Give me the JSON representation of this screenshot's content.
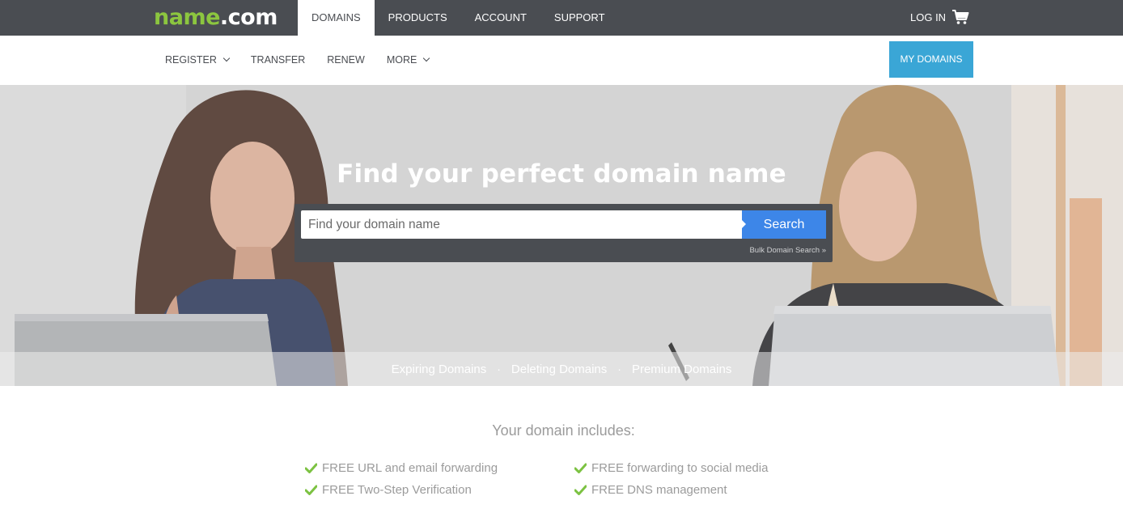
{
  "brand": {
    "part1": "name",
    "part2": ".com"
  },
  "topnav": {
    "items": [
      {
        "label": "DOMAINS",
        "active": true
      },
      {
        "label": "PRODUCTS"
      },
      {
        "label": "ACCOUNT"
      },
      {
        "label": "SUPPORT"
      }
    ],
    "login_label": "LOG IN",
    "cart_icon": "shopping-cart-icon"
  },
  "subnav": {
    "items": [
      {
        "label": "REGISTER",
        "has_dropdown": true
      },
      {
        "label": "TRANSFER"
      },
      {
        "label": "RENEW"
      },
      {
        "label": "MORE",
        "has_dropdown": true
      }
    ],
    "my_domains_label": "MY DOMAINS"
  },
  "hero": {
    "title": "Find your perfect domain name",
    "search": {
      "placeholder": "Find your domain name",
      "value": "",
      "button_label": "Search",
      "bulk_link": "Bulk Domain Search »"
    },
    "links": [
      "Expiring Domains",
      "Deleting Domains",
      "Premium Domains"
    ],
    "separator": "·"
  },
  "includes": {
    "title": "Your domain includes:",
    "features": [
      "FREE URL and email forwarding",
      "FREE forwarding to social media",
      "FREE Two-Step Verification",
      "FREE DNS management"
    ]
  },
  "colors": {
    "topbar": "#4a4d52",
    "brand_green": "#8cc63f",
    "accent_blue": "#3aa6d6",
    "search_blue": "#3d86e8",
    "check_green": "#7cc242",
    "muted_text": "#9b9b9b"
  }
}
